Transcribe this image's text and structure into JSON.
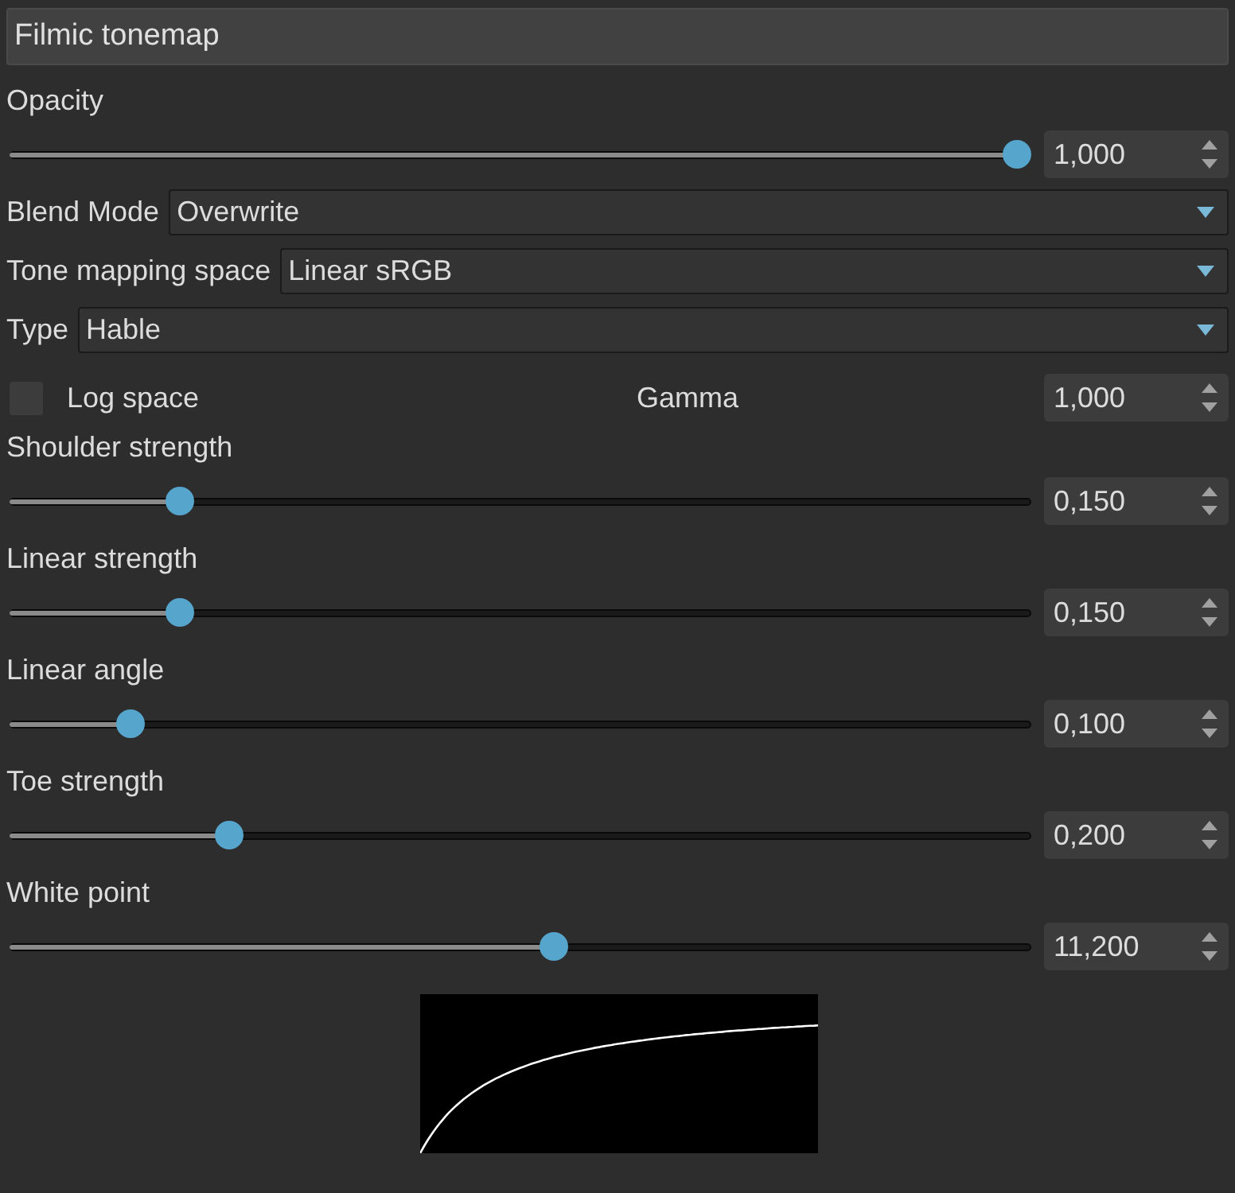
{
  "panel": {
    "title": "Filmic tonemap"
  },
  "controls": [
    {
      "kind": "slider",
      "label": "Opacity",
      "level": 1,
      "value": "1,000"
    },
    {
      "kind": "dropdown",
      "label": "Blend Mode",
      "value": "Overwrite"
    },
    {
      "kind": "dropdown",
      "label": "Tone mapping space",
      "value": "Linear sRGB"
    },
    {
      "kind": "dropdown",
      "label": "Type",
      "value": "Hable"
    },
    {
      "kind": "checkrow",
      "label": "Log space",
      "checked": false,
      "field_label": "Gamma",
      "value": "1,000"
    },
    {
      "kind": "slider",
      "label": "Shoulder strength",
      "level": 0.157,
      "value": "0,150"
    },
    {
      "kind": "slider",
      "label": "Linear strength",
      "level": 0.157,
      "value": "0,150"
    },
    {
      "kind": "slider",
      "label": "Linear angle",
      "level": 0.107,
      "value": "0,100"
    },
    {
      "kind": "slider",
      "label": "Toe strength",
      "level": 0.207,
      "value": "0,200"
    },
    {
      "kind": "slider",
      "label": "White point",
      "level": 0.533,
      "value": "11,200"
    }
  ]
}
